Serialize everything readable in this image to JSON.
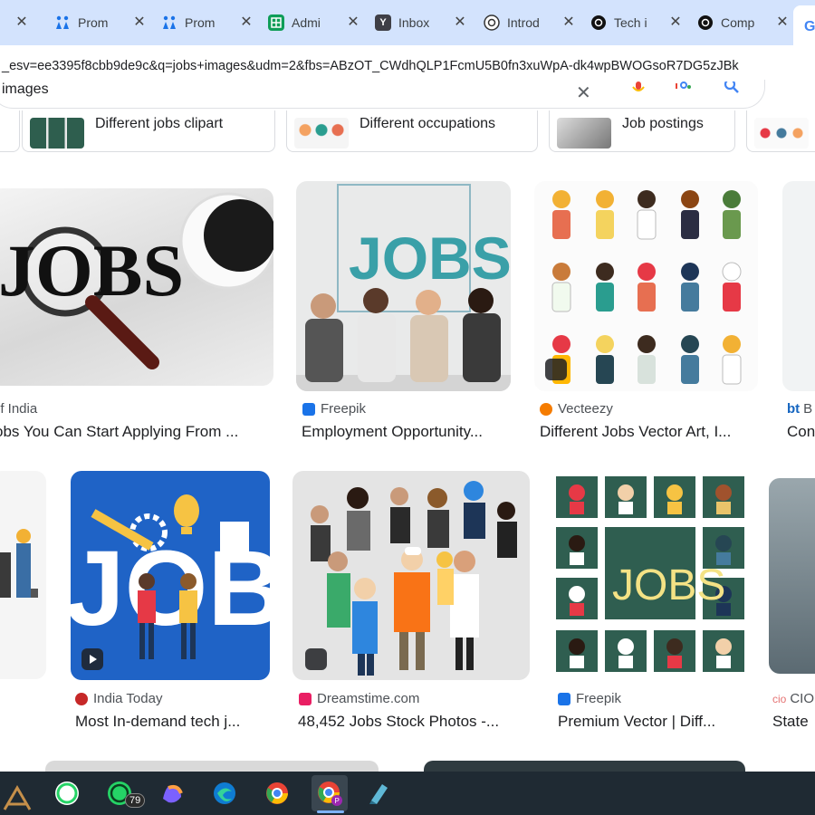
{
  "tabs": [
    {
      "title": "Prom",
      "icon": "person-pin-icon"
    },
    {
      "title": "Prom",
      "icon": "person-pin-icon"
    },
    {
      "title": "Admi",
      "icon": "sheets-icon"
    },
    {
      "title": "Inbox",
      "icon": "yahoo-y-icon"
    },
    {
      "title": "Introd",
      "icon": "openai-icon"
    },
    {
      "title": "Tech i",
      "icon": "openai-icon"
    },
    {
      "title": "Comp",
      "icon": "openai-icon"
    },
    {
      "title": "",
      "icon": "google-g-icon"
    }
  ],
  "address_bar": {
    "url": "_esv=ee3395f8cbb9de9c&q=jobs+images&udm=2&fbs=ABzOT_CWdhQLP1FcmU5B0fn3xuWpA-dk4wpBWOGsoR7DG5zJBk"
  },
  "search": {
    "query": "images"
  },
  "chips": [
    {
      "label": "Different jobs clipart"
    },
    {
      "label": "Different occupations"
    },
    {
      "label": "Job postings"
    }
  ],
  "row1": [
    {
      "source": "of India",
      "title": "obs You Can Start Applying From ..."
    },
    {
      "source": "Freepik",
      "title": "Employment Opportunity..."
    },
    {
      "source": "Vecteezy",
      "title": "Different Jobs Vector Art, I..."
    },
    {
      "source": "B",
      "title": "Con"
    }
  ],
  "row2": [
    {
      "source": "India Today",
      "title": "Most In-demand tech j..."
    },
    {
      "source": "Dreamstime.com",
      "title": "48,452 Jobs Stock Photos -..."
    },
    {
      "source": "Freepik",
      "title": "Premium Vector | Diff..."
    },
    {
      "source": "CIO",
      "title": "State"
    }
  ],
  "image_text": {
    "jobs_word": "JOBS",
    "job_word": "JOB",
    "lower_jobs": "JOBS"
  },
  "taskbar": {
    "whatsapp_badge": "79"
  },
  "colors": {
    "tabstrip": "#d3e3fd",
    "taskbar": "#1f2a33",
    "freepik": "#1a73e8",
    "vecteezy": "#f57c00",
    "india_today": "#c62828",
    "dreamstime": "#e91e63"
  }
}
